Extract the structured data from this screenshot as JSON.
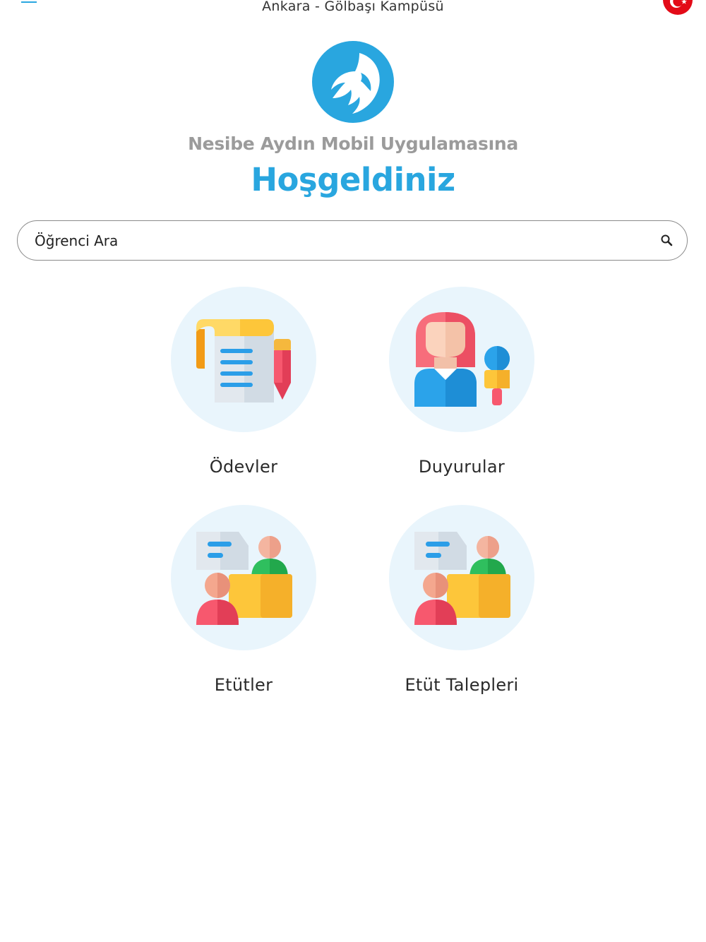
{
  "header": {
    "campus_name": "Ankara - Gölbaşı Kampüsü",
    "menu_icon": "hamburger-menu-icon",
    "language_icon": "turkey-flag-icon"
  },
  "welcome": {
    "subtitle": "Nesibe Aydın Mobil Uygulamasına",
    "title": "Hoşgeldiniz"
  },
  "search": {
    "placeholder": "Öğrenci Ara",
    "icon": "search-icon"
  },
  "menu_tiles": [
    {
      "label": "Ödevler",
      "icon": "homework-icon"
    },
    {
      "label": "Duyurular",
      "icon": "announcement-icon"
    },
    {
      "label": "Etütler",
      "icon": "study-session-icon"
    },
    {
      "label": "Etüt Talepleri",
      "icon": "study-request-icon"
    }
  ],
  "colors": {
    "brand_blue": "#29a6df",
    "subtitle_gray": "#9b9b9b",
    "tile_background": "#e9f5fc"
  }
}
